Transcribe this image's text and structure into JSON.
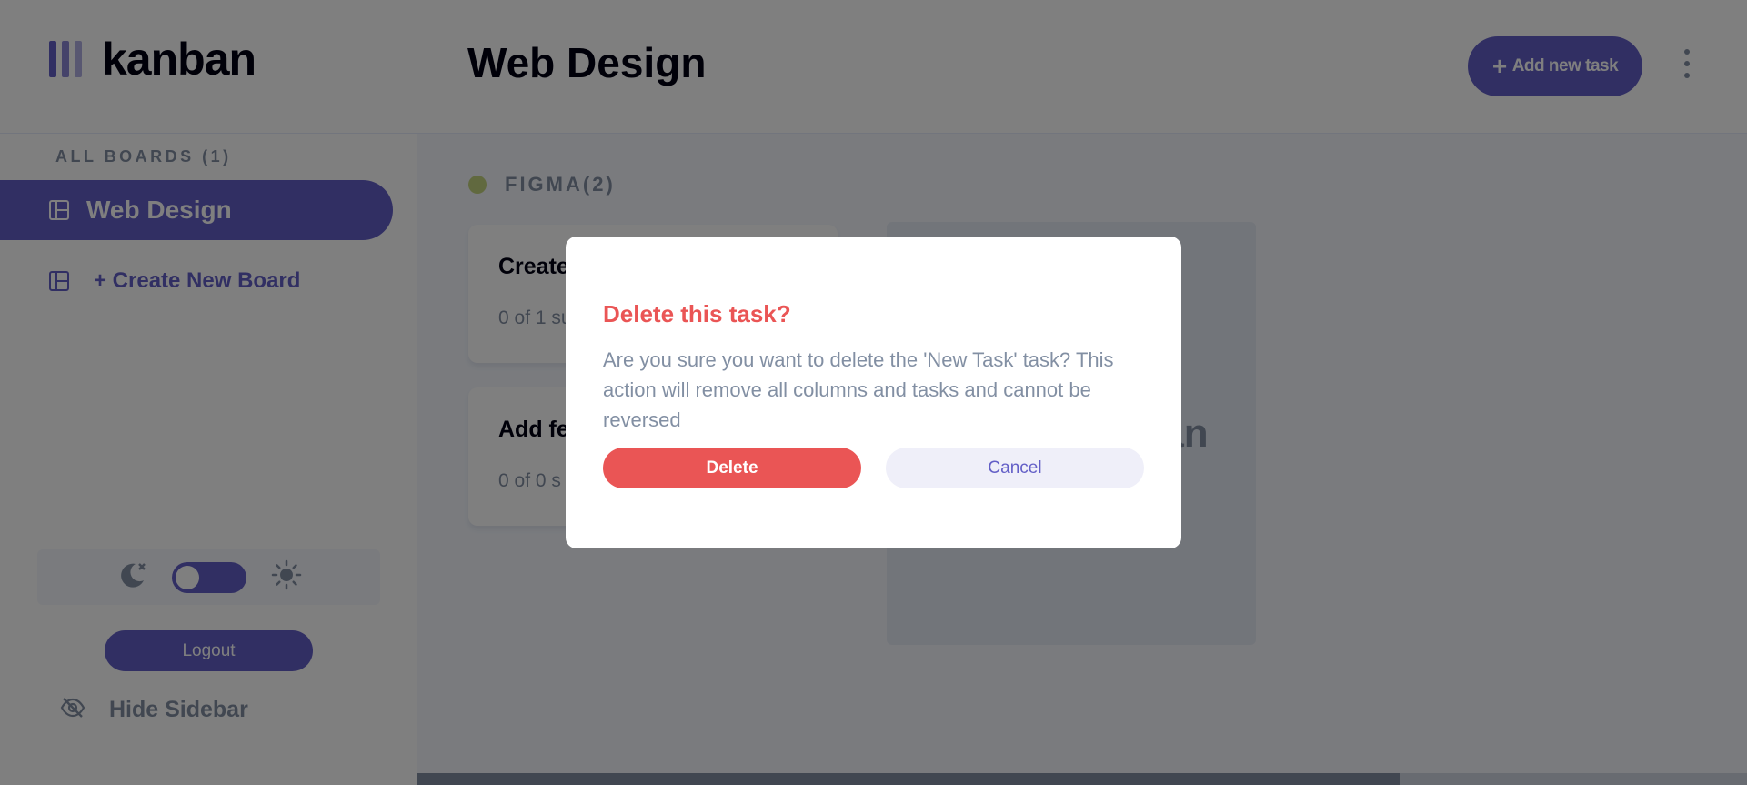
{
  "sidebar": {
    "logo_text": "kanban",
    "boards_heading": "ALL BOARDS (1)",
    "boards": [
      {
        "label": "Web Design",
        "active": true
      }
    ],
    "create_board_label": "+ Create New Board",
    "logout_label": "Logout",
    "hide_sidebar_label": "Hide Sidebar",
    "theme_toggle": {
      "mode": "light",
      "left_icon": "moon-icon",
      "right_icon": "sun-icon"
    }
  },
  "header": {
    "title": "Web Design",
    "add_task_label": "Add new task",
    "add_task_icon": "plus-icon",
    "more_icon": "vertical-ellipsis-icon"
  },
  "board": {
    "columns": [
      {
        "title": "FIGMA(2)",
        "dot_color": "#c3d37e",
        "tasks": [
          {
            "title": "Create",
            "subtasks": "0 of 1 su"
          },
          {
            "title": "Add fe",
            "subtasks": "0 of 0 s"
          }
        ]
      }
    ],
    "new_column_text": "an"
  },
  "modal": {
    "title": "Delete this task?",
    "body": "Are you sure you want to delete the 'New Task' task? This action will remove all columns and tasks and cannot be reversed",
    "delete_label": "Delete",
    "cancel_label": "Cancel"
  },
  "colors": {
    "accent": "#635fc7",
    "danger": "#ea5555",
    "muted": "#828fa3",
    "background": "#f4f7fd"
  }
}
